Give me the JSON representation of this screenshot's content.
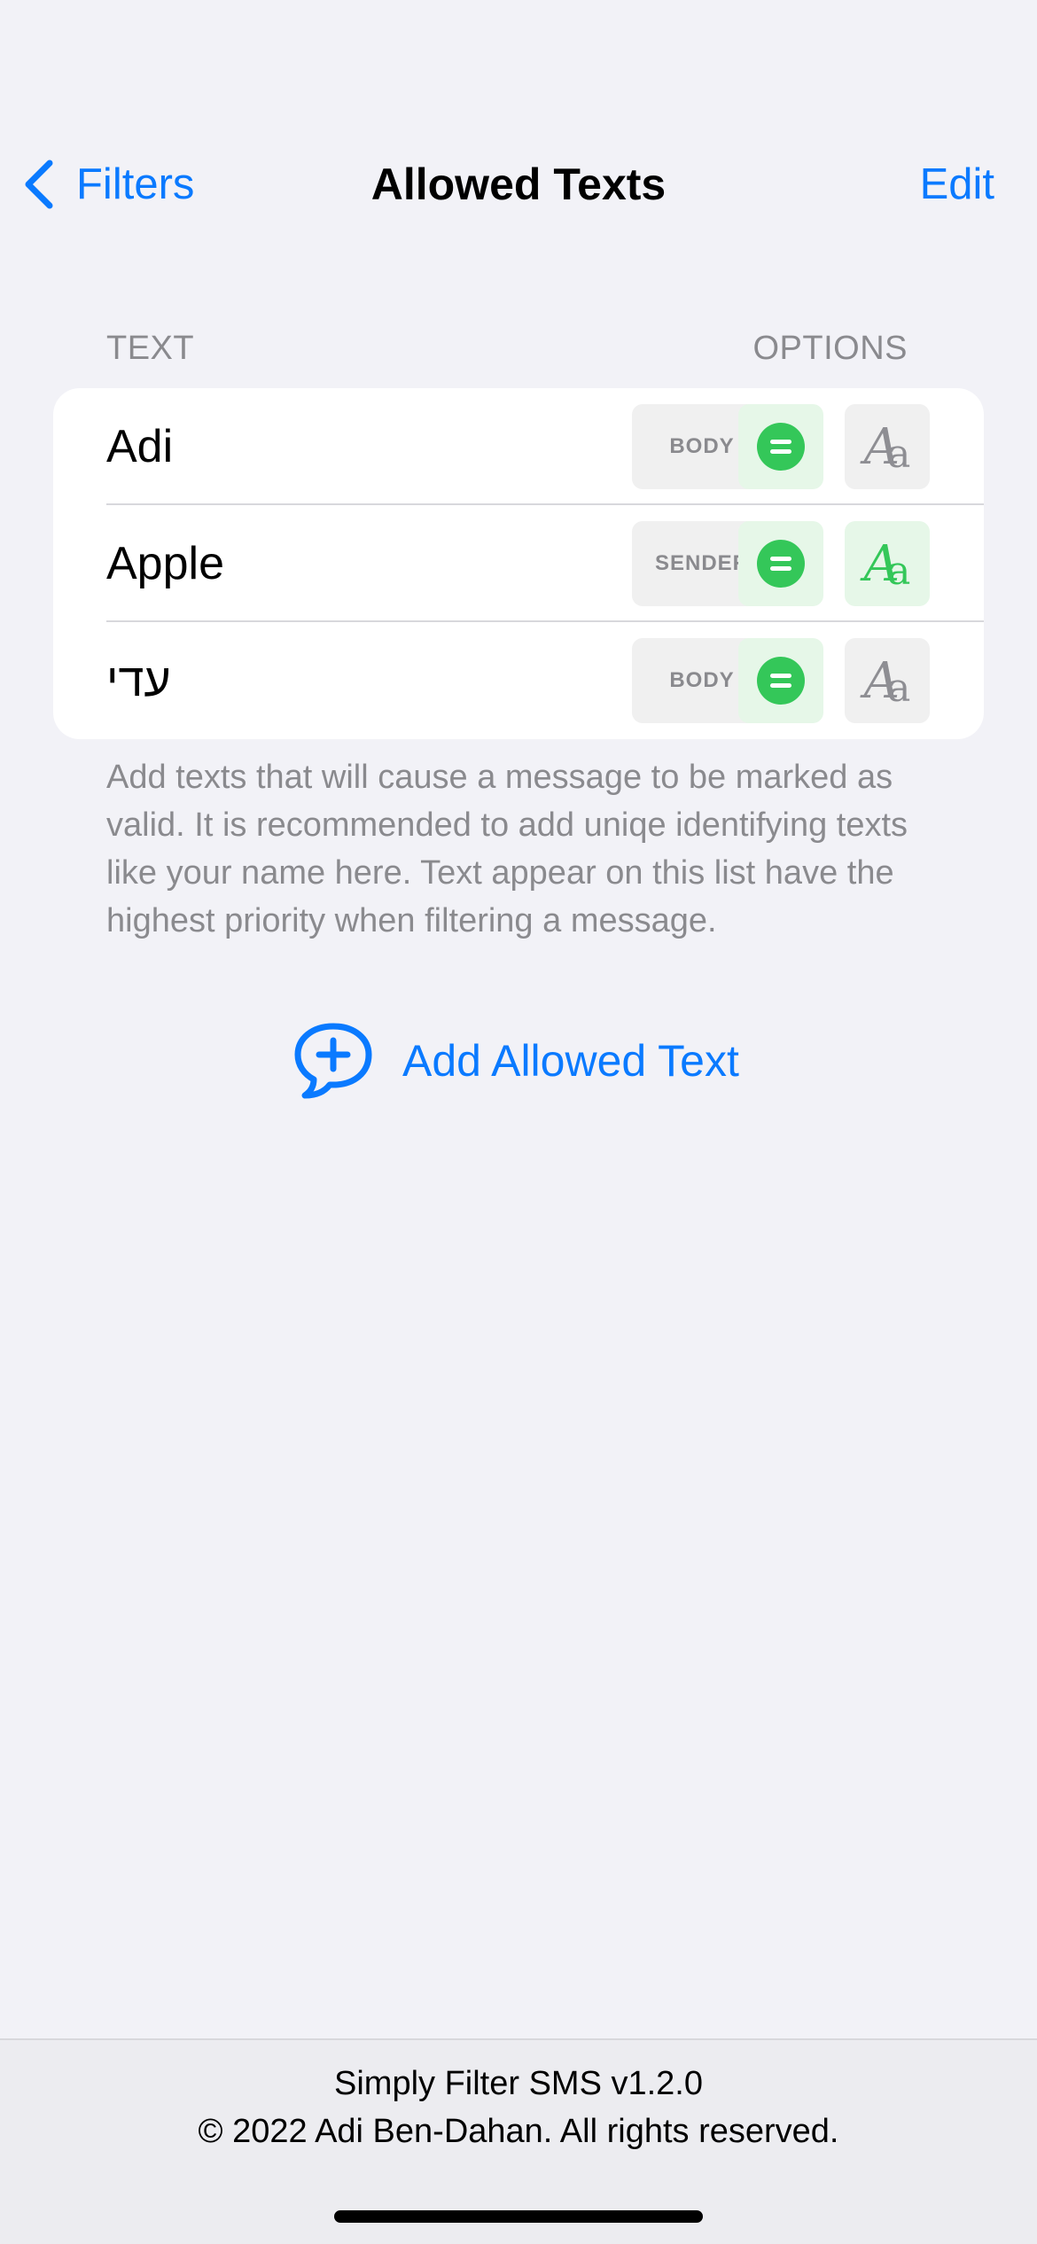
{
  "nav": {
    "back_label": "Filters",
    "title": "Allowed Texts",
    "edit_label": "Edit"
  },
  "section": {
    "text_header": "TEXT",
    "options_header": "OPTIONS"
  },
  "rows": [
    {
      "label": "Adi",
      "match_target": "BODY",
      "exact_match": true,
      "case_sensitive": false
    },
    {
      "label": "Apple",
      "match_target": "SENDER",
      "exact_match": true,
      "case_sensitive": true
    },
    {
      "label": "עדי",
      "match_target": "BODY",
      "exact_match": true,
      "case_sensitive": false
    }
  ],
  "case_glyph": {
    "big": "A",
    "small": "a"
  },
  "footnote": "Add texts that will cause a message to be marked as valid. It is recommended to add uniqe identifying texts like your name here. Text appear on this list have the highest priority when filtering a message.",
  "add_button": {
    "label": "Add Allowed Text",
    "icon": "plus-bubble-icon"
  },
  "footer": {
    "app_version": "Simply Filter SMS v1.2.0",
    "copyright": "© 2022 Adi Ben-Dahan. All rights reserved."
  },
  "colors": {
    "accent": "#0a7aff",
    "green": "#34c759",
    "background": "#f2f2f7"
  }
}
